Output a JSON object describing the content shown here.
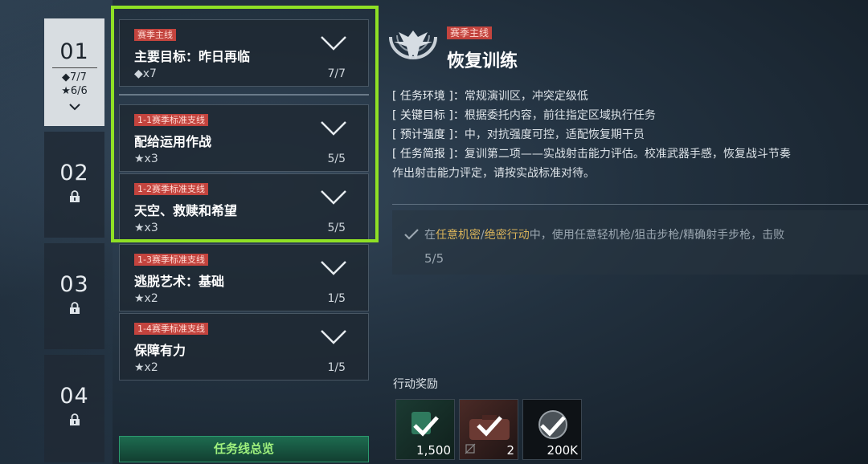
{
  "chapters": [
    {
      "num": "01",
      "diamond": "◆7/7",
      "star": "★6/6",
      "active": true
    },
    {
      "num": "02",
      "locked": true
    },
    {
      "num": "03",
      "locked": true
    },
    {
      "num": "04",
      "locked": true
    }
  ],
  "quests": [
    {
      "tag": "赛季主线",
      "title": "主要目标：昨日再临",
      "reward": "◆x7",
      "progress": "7/7"
    },
    {
      "tag": "1-1赛季标准支线",
      "title": "配给运用作战",
      "reward": "★x3",
      "progress": "5/5"
    },
    {
      "tag": "1-2赛季标准支线",
      "title": "天空、救赎和希望",
      "reward": "★x3",
      "progress": "5/5"
    },
    {
      "tag": "1-3赛季标准支线",
      "title": "逃脱艺术：基础",
      "reward": "★x2",
      "progress": "1/5"
    },
    {
      "tag": "1-4赛季标准支线",
      "title": "保障有力",
      "reward": "★x2",
      "progress": "1/5"
    }
  ],
  "overview_button": "任务线总览",
  "detail": {
    "tag": "赛季主线",
    "title": "恢复训练",
    "info": [
      {
        "k": "[ 任务环境 ]：",
        "v": "常规演训区，冲突定级低"
      },
      {
        "k": "[ 关键目标 ]：",
        "v": "根据委托内容，前往指定区域执行任务"
      },
      {
        "k": "[ 预计强度 ]：",
        "v": "中，对抗强度可控，适配恢复期干员"
      },
      {
        "k": "[ 任务简报 ]：",
        "v": "复训第二项——实战射击能力评估。校准武器手感，恢复战斗节奏"
      }
    ],
    "info_cont": "作出射击能力评定，请按实战标准对待。",
    "objective": {
      "pre": "在",
      "hl1": "任意机密",
      "mid": "/",
      "hl2": "绝密行动",
      "post": "中，使用任意轻机枪/狙击步枪/精确射手步枪，击败",
      "progress": "5/5"
    }
  },
  "rewards_title": "行动奖励",
  "rewards": [
    {
      "amount": "1,500"
    },
    {
      "amount": "2"
    },
    {
      "amount": "200K"
    }
  ],
  "colors": {
    "highlight": "#8fe025",
    "tag": "#c3443e",
    "objective_hl": "#d9b35a"
  }
}
